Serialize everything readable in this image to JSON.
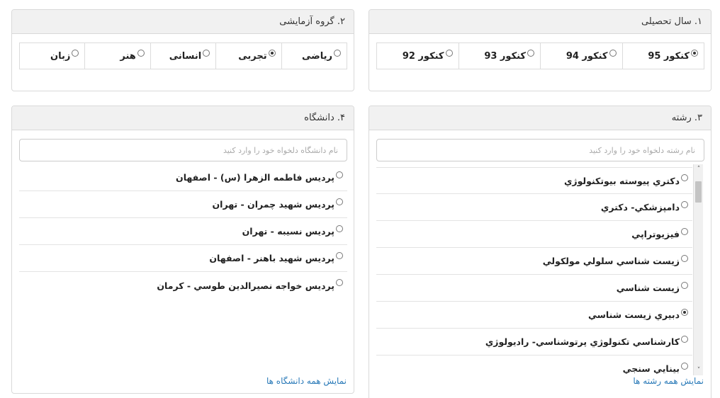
{
  "panel1": {
    "title": "۱. سال تحصیلی",
    "options": [
      {
        "label": "کنکور 95",
        "checked": true
      },
      {
        "label": "کنکور 94",
        "checked": false
      },
      {
        "label": "کنکور 93",
        "checked": false
      },
      {
        "label": "کنکور 92",
        "checked": false
      }
    ]
  },
  "panel2": {
    "title": "۲. گروه آزمایشی",
    "options": [
      {
        "label": "ریاضی",
        "checked": false
      },
      {
        "label": "تجربی",
        "checked": true
      },
      {
        "label": "انسانی",
        "checked": false
      },
      {
        "label": "هنر",
        "checked": false
      },
      {
        "label": "زبان",
        "checked": false
      }
    ]
  },
  "panel3": {
    "title": "۳. رشته",
    "search_placeholder": "نام رشته دلخواه خود را وارد کنید",
    "items": [
      {
        "label": "دکتري پيوسته بيوتکنولوژي",
        "checked": false
      },
      {
        "label": "دامپزشکي- دکتري",
        "checked": false
      },
      {
        "label": "فيزيوتراپي",
        "checked": false
      },
      {
        "label": "زيست شناسي سلولي مولکولي",
        "checked": false
      },
      {
        "label": "زيست شناسي",
        "checked": false
      },
      {
        "label": "دبيري زيست شناسي",
        "checked": true
      },
      {
        "label": "کارشناسي تکنولوژي پرتوشناسي- راديولوژي",
        "checked": false
      },
      {
        "label": "بينايي سنجي",
        "checked": false
      }
    ],
    "show_all_link": "نمایش همه رشته ها"
  },
  "panel4": {
    "title": "۴. دانشگاه",
    "search_placeholder": "نام دانشگاه دلخواه خود را وارد کنید",
    "items": [
      {
        "label": "پرديس فاطمه الزهرا (س) - اصفهان",
        "checked": false
      },
      {
        "label": "پرديس شهيد چمران - تهران",
        "checked": false
      },
      {
        "label": "پرديس نسيبه - تهران",
        "checked": false
      },
      {
        "label": "پرديس شهيد باهنر - اصفهان",
        "checked": false
      },
      {
        "label": "پرديس خواجه نصيرالدين طوسي - کرمان",
        "checked": false
      }
    ],
    "show_all_link": "نمایش همه دانشگاه ها"
  }
}
